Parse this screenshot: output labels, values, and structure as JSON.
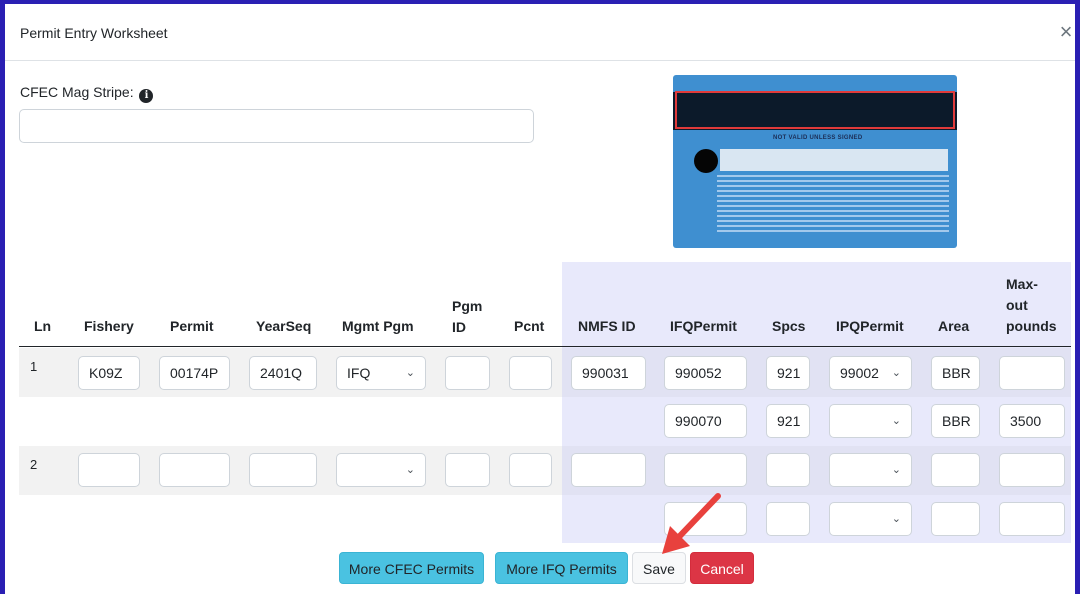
{
  "modal": {
    "title": "Permit Entry Worksheet",
    "close_glyph": "×"
  },
  "mag_stripe": {
    "label": "CFEC Mag Stripe:",
    "info_glyph": "i",
    "value": ""
  },
  "card": {
    "not_valid_text": "NOT VALID UNLESS SIGNED"
  },
  "columns": {
    "ln": "Ln",
    "fishery": "Fishery",
    "permit": "Permit",
    "yearseq": "YearSeq",
    "mgmt_pgm": "Mgmt Pgm",
    "pgm_id_1": "Pgm",
    "pgm_id_2": "ID",
    "pcnt": "Pcnt",
    "nmfs_id": "NMFS ID",
    "ifqpermit": "IFQPermit",
    "spcs": "Spcs",
    "ipqpermit": "IPQPermit",
    "area": "Area",
    "maxout_1": "Max-",
    "maxout_2": "out",
    "maxout_3": "pounds"
  },
  "rows": [
    {
      "ln": "1",
      "fishery": "K09Z",
      "permit": "00174P",
      "yearseq": "2401Q",
      "mgmt_pgm": "IFQ",
      "pgm_id": "",
      "pcnt": "",
      "nmfs_id": "990031",
      "ifq": [
        {
          "ifqpermit": "990052",
          "spcs": "921",
          "ipqpermit": "99002",
          "area": "BBR",
          "max_out": ""
        },
        {
          "ifqpermit": "990070",
          "spcs": "921",
          "ipqpermit": "",
          "area": "BBR",
          "max_out": "3500"
        }
      ]
    },
    {
      "ln": "2",
      "fishery": "",
      "permit": "",
      "yearseq": "",
      "mgmt_pgm": "",
      "pgm_id": "",
      "pcnt": "",
      "nmfs_id": "",
      "ifq": [
        {
          "ifqpermit": "",
          "spcs": "",
          "ipqpermit": "",
          "area": "",
          "max_out": ""
        },
        {
          "ifqpermit": "",
          "spcs": "",
          "ipqpermit": "",
          "area": "",
          "max_out": ""
        }
      ]
    }
  ],
  "select_chevron": "⌄",
  "buttons": {
    "more_cfec": "More CFEC Permits",
    "more_ifq": "More IFQ Permits",
    "save": "Save",
    "cancel": "Cancel"
  },
  "colors": {
    "frame": "#2a1fb3",
    "info_button": "#4ac2e1",
    "danger_button": "#dc3545",
    "ifq_panel": "#e8e9fb",
    "arrow": "#e8413d"
  }
}
